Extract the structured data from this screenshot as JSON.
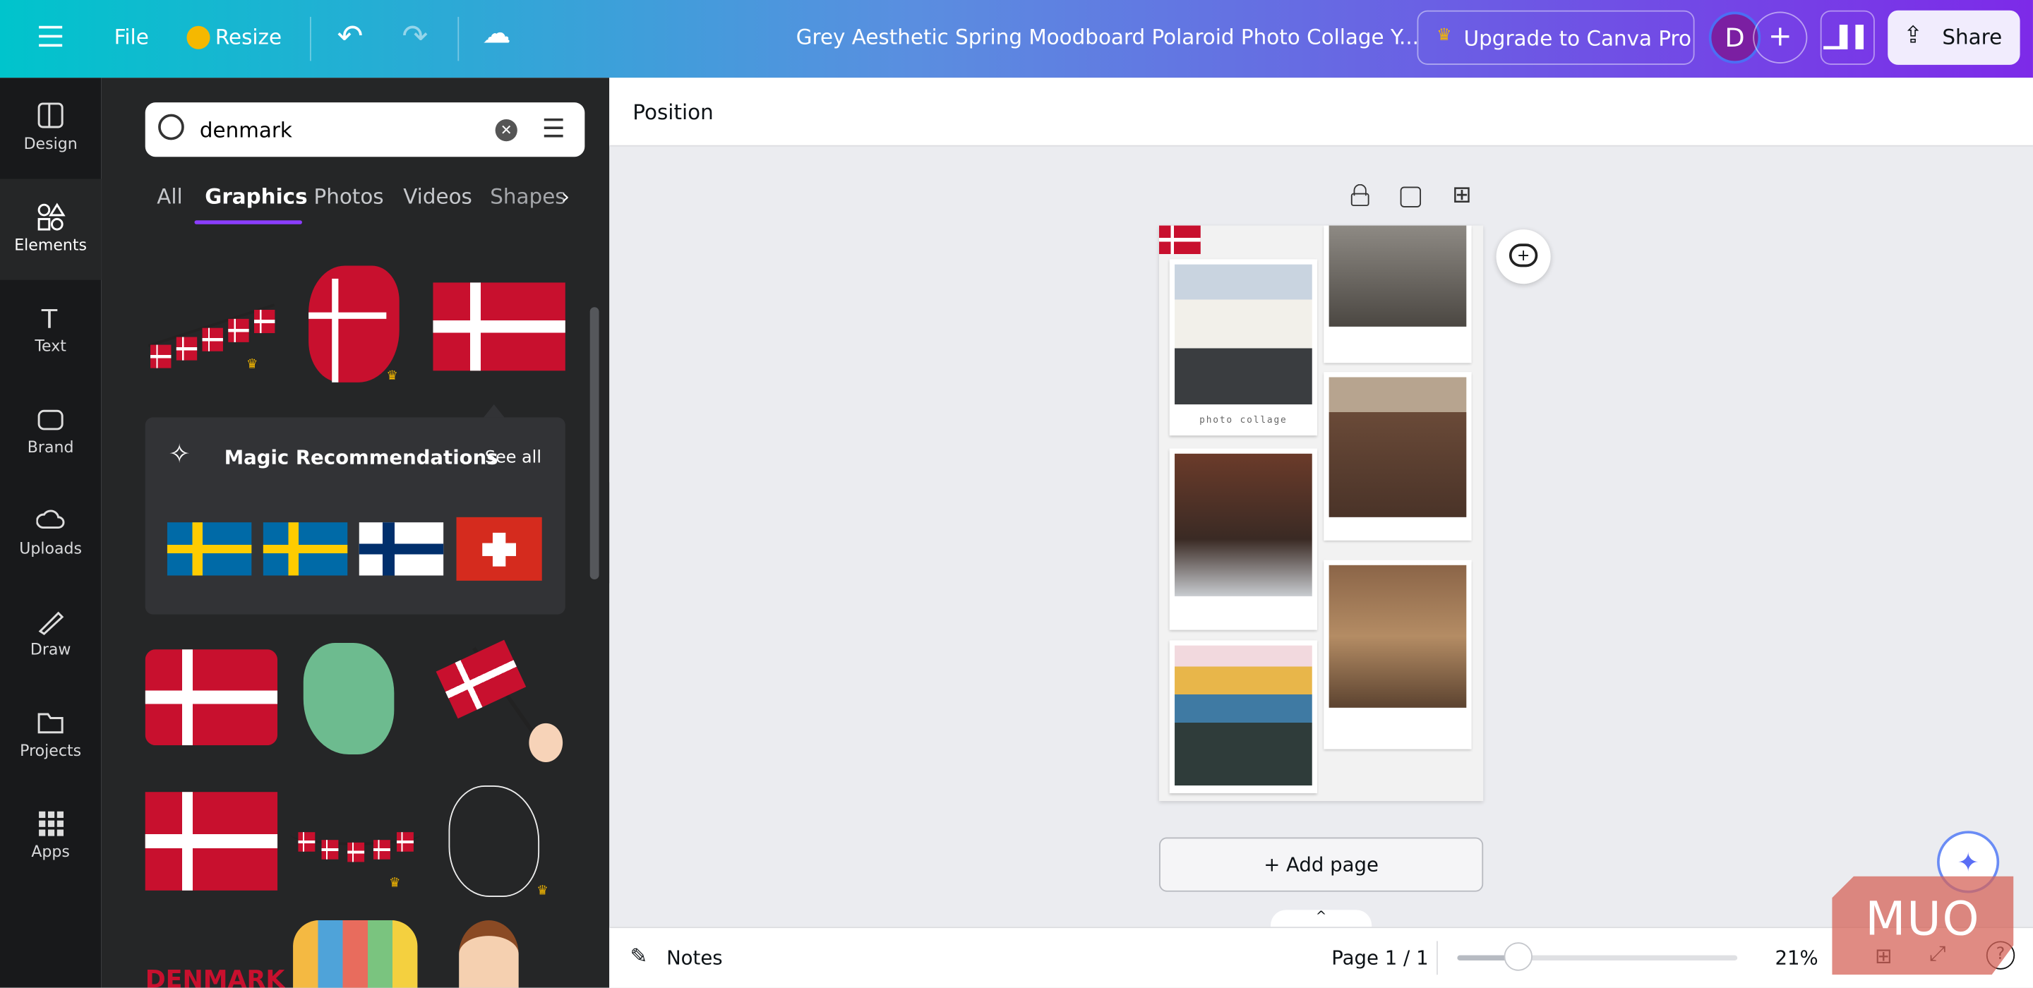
{
  "topbar": {
    "file": "File",
    "resize": "Resize",
    "title": "Grey Aesthetic Spring Moodboard Polaroid Photo Collage Y...",
    "upgrade": "Upgrade to Canva Pro",
    "avatar": "D",
    "share": "Share",
    "gradient": [
      "#00c4cc",
      "#7d2ae8"
    ]
  },
  "rail": [
    {
      "label": "Design",
      "icon": "layout-icon"
    },
    {
      "label": "Elements",
      "icon": "shapes-icon"
    },
    {
      "label": "Text",
      "icon": "text-icon"
    },
    {
      "label": "Brand",
      "icon": "brand-icon"
    },
    {
      "label": "Uploads",
      "icon": "cloud-upload-icon"
    },
    {
      "label": "Draw",
      "icon": "pen-icon"
    },
    {
      "label": "Projects",
      "icon": "folder-icon"
    },
    {
      "label": "Apps",
      "icon": "grid-icon"
    }
  ],
  "search": {
    "value": "denmark"
  },
  "tabs": [
    "All",
    "Graphics",
    "Photos",
    "Videos",
    "Shapes"
  ],
  "magic": {
    "title": "Magic Recommendations",
    "see_all": "See all",
    "flags": [
      "sweden",
      "sweden",
      "finland",
      "switzerland"
    ]
  },
  "toolbar": {
    "position": "Position"
  },
  "canvas": {
    "caption": "photo collage",
    "add_page": "+ Add page"
  },
  "bottom": {
    "notes": "Notes",
    "page": "Page 1 / 1",
    "zoom": "21%",
    "zoom_value": 21
  },
  "graphic_text": "DENMARK",
  "watermark": "MUO"
}
